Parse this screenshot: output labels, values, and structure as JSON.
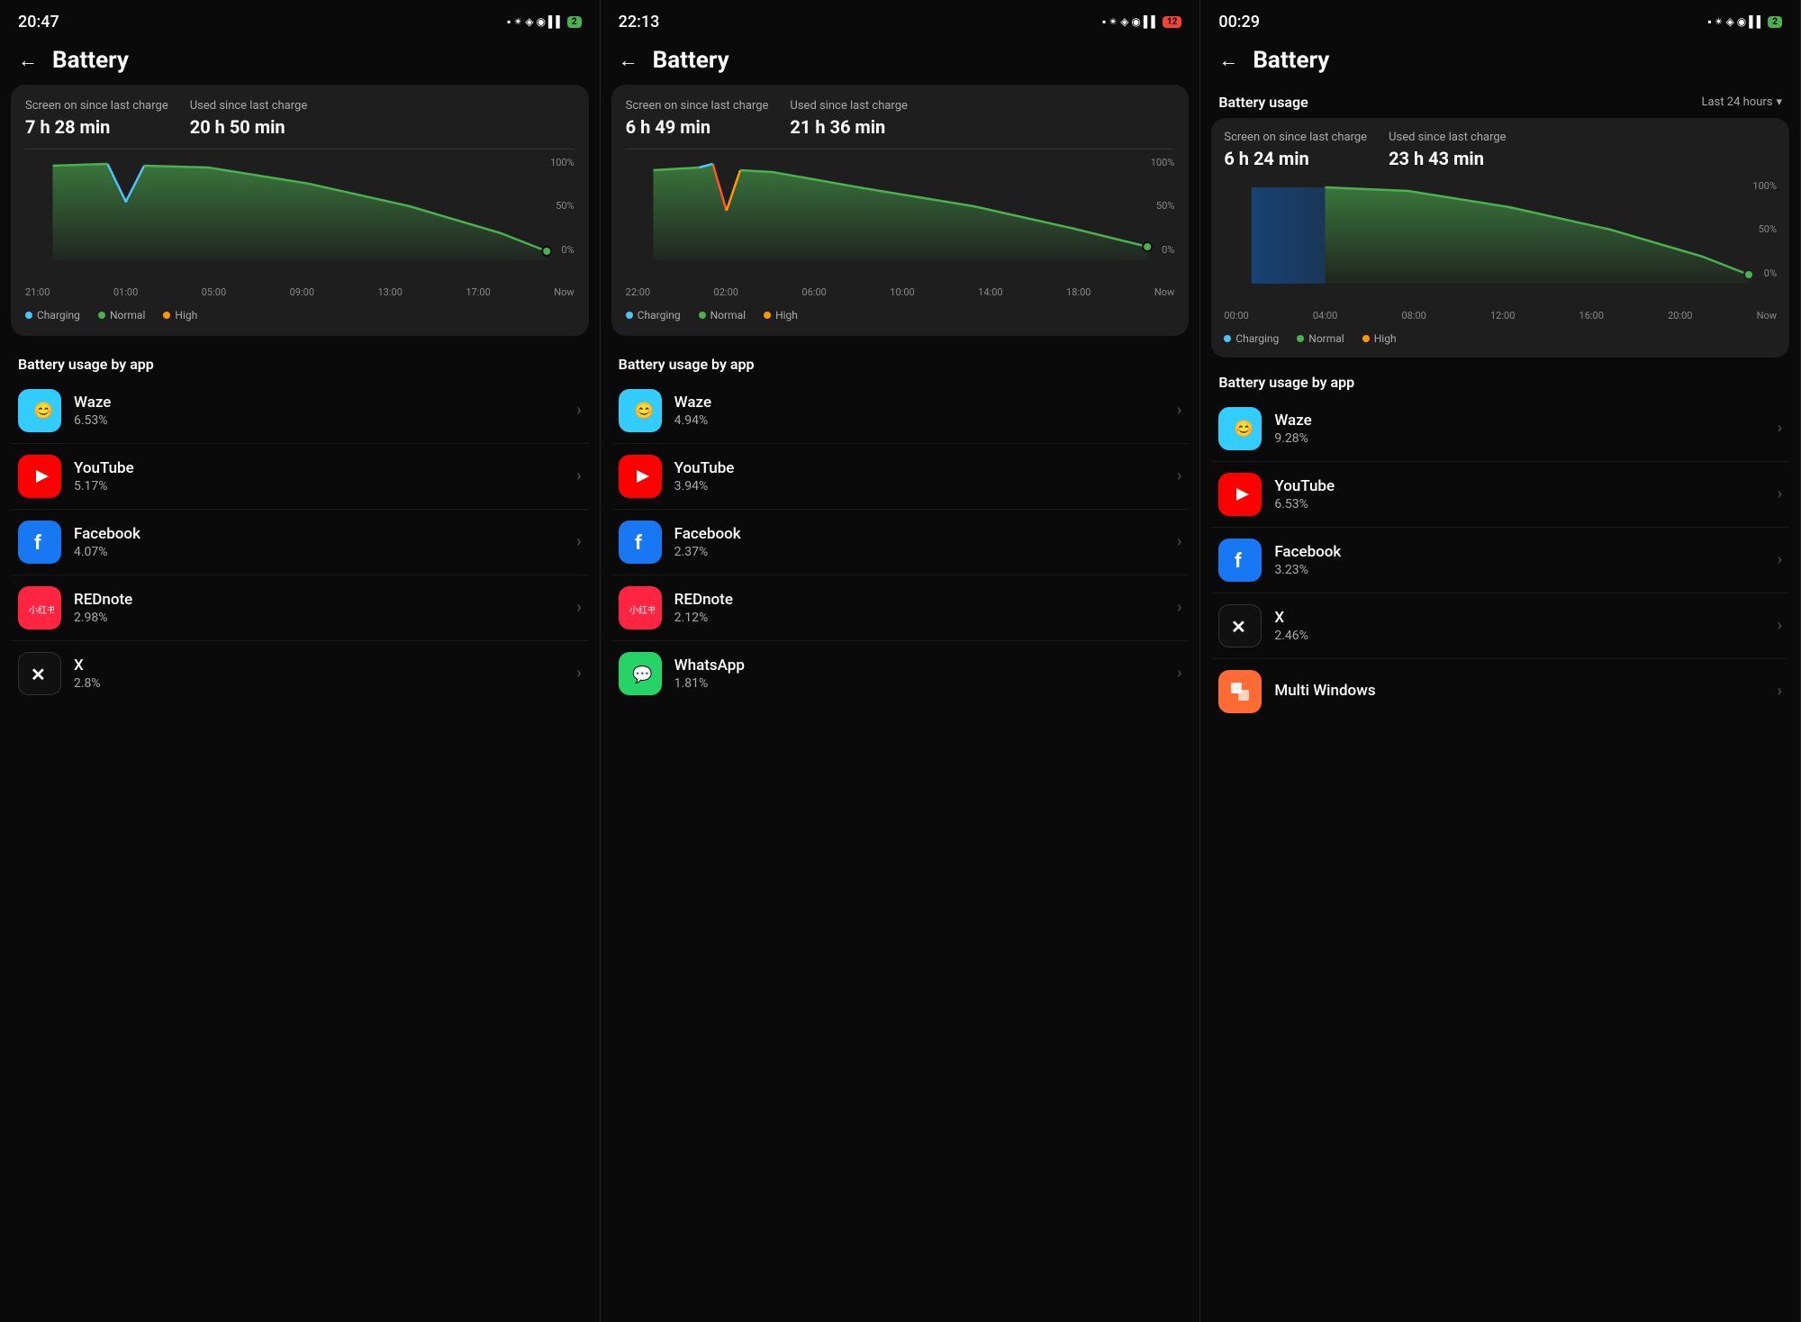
{
  "panels": [
    {
      "id": "panel1",
      "statusBar": {
        "time": "20:47",
        "batteryLevel": "2",
        "batteryColor": "green"
      },
      "header": {
        "backLabel": "←",
        "title": "Battery"
      },
      "card": {
        "screenOnLabel": "Screen on since last charge",
        "screenOnValue": "7 h 28 min",
        "usedSinceLabel": "Used since last charge",
        "usedSinceValue": "20 h 50 min"
      },
      "chart": {
        "xLabels": [
          "21:00",
          "01:00",
          "05:00",
          "09:00",
          "13:00",
          "17:00",
          "Now"
        ],
        "yLabels": [
          "100%",
          "50%",
          "0%"
        ]
      },
      "legend": [
        {
          "color": "#4fc3f7",
          "label": "Charging"
        },
        {
          "color": "#4caf50",
          "label": "Normal"
        },
        {
          "color": "#ff9800",
          "label": "High"
        }
      ],
      "sectionTitle": "Battery usage by app",
      "apps": [
        {
          "name": "Waze",
          "pct": "6.53%",
          "iconClass": "icon-waze",
          "emoji": "😊"
        },
        {
          "name": "YouTube",
          "pct": "5.17%",
          "iconClass": "icon-youtube",
          "emoji": "▶"
        },
        {
          "name": "Facebook",
          "pct": "4.07%",
          "iconClass": "icon-facebook",
          "emoji": "f"
        },
        {
          "name": "REDnote",
          "pct": "2.98%",
          "iconClass": "icon-rednote",
          "emoji": "小红书"
        },
        {
          "name": "X",
          "pct": "2.8%",
          "iconClass": "icon-x",
          "emoji": "✕"
        }
      ]
    },
    {
      "id": "panel2",
      "statusBar": {
        "time": "22:13",
        "batteryLevel": "12",
        "batteryColor": "red"
      },
      "header": {
        "backLabel": "←",
        "title": "Battery"
      },
      "card": {
        "screenOnLabel": "Screen on since last charge",
        "screenOnValue": "6 h 49 min",
        "usedSinceLabel": "Used since last charge",
        "usedSinceValue": "21 h 36 min"
      },
      "chart": {
        "xLabels": [
          "22:00",
          "02:00",
          "06:00",
          "10:00",
          "14:00",
          "18:00",
          "Now"
        ],
        "yLabels": [
          "100%",
          "50%",
          "0%"
        ]
      },
      "legend": [
        {
          "color": "#4fc3f7",
          "label": "Charging"
        },
        {
          "color": "#4caf50",
          "label": "Normal"
        },
        {
          "color": "#ff9800",
          "label": "High"
        }
      ],
      "sectionTitle": "Battery usage by app",
      "apps": [
        {
          "name": "Waze",
          "pct": "4.94%",
          "iconClass": "icon-waze",
          "emoji": "😊"
        },
        {
          "name": "YouTube",
          "pct": "3.94%",
          "iconClass": "icon-youtube",
          "emoji": "▶"
        },
        {
          "name": "Facebook",
          "pct": "2.37%",
          "iconClass": "icon-facebook",
          "emoji": "f"
        },
        {
          "name": "REDnote",
          "pct": "2.12%",
          "iconClass": "icon-rednote",
          "emoji": "小红书"
        },
        {
          "name": "WhatsApp",
          "pct": "1.81%",
          "iconClass": "icon-whatsapp",
          "emoji": "📱"
        }
      ]
    },
    {
      "id": "panel3",
      "statusBar": {
        "time": "00:29",
        "batteryLevel": "2",
        "batteryColor": "green"
      },
      "header": {
        "backLabel": "←",
        "title": "Battery"
      },
      "usageHeader": {
        "title": "Battery usage",
        "filter": "Last 24 hours",
        "filterIcon": "▾"
      },
      "card": {
        "screenOnLabel": "Screen on since last charge",
        "screenOnValue": "6 h 24 min",
        "usedSinceLabel": "Used since last charge",
        "usedSinceValue": "23 h 43 min"
      },
      "chart": {
        "xLabels": [
          "00:00",
          "04:00",
          "08:00",
          "12:00",
          "16:00",
          "20:00",
          "Now"
        ],
        "yLabels": [
          "100%",
          "50%",
          "0%"
        ]
      },
      "legend": [
        {
          "color": "#4fc3f7",
          "label": "Charging"
        },
        {
          "color": "#4caf50",
          "label": "Normal"
        },
        {
          "color": "#ff9800",
          "label": "High"
        }
      ],
      "sectionTitle": "Battery usage by app",
      "apps": [
        {
          "name": "Waze",
          "pct": "9.28%",
          "iconClass": "icon-waze",
          "emoji": "😊"
        },
        {
          "name": "YouTube",
          "pct": "6.53%",
          "iconClass": "icon-youtube",
          "emoji": "▶"
        },
        {
          "name": "Facebook",
          "pct": "3.23%",
          "iconClass": "icon-facebook",
          "emoji": "f"
        },
        {
          "name": "X",
          "pct": "2.46%",
          "iconClass": "icon-x",
          "emoji": "✕"
        },
        {
          "name": "Multi Windows",
          "pct": "",
          "iconClass": "icon-multiwindow",
          "emoji": "⊞"
        }
      ]
    }
  ]
}
